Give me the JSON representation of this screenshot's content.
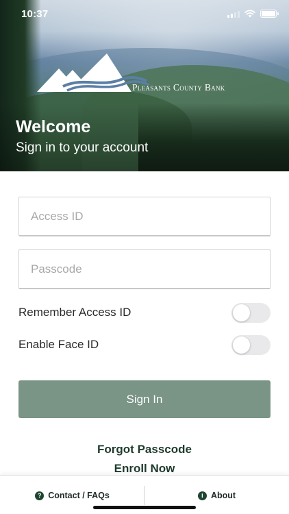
{
  "status_bar": {
    "time": "10:37"
  },
  "brand": {
    "name": "Pleasants County Bank"
  },
  "hero": {
    "title": "Welcome",
    "subtitle": "Sign in to your account"
  },
  "form": {
    "access_id": {
      "placeholder": "Access ID",
      "value": ""
    },
    "passcode": {
      "placeholder": "Passcode",
      "value": ""
    },
    "remember_access_id": {
      "label": "Remember Access ID",
      "on": false
    },
    "enable_face_id": {
      "label": "Enable Face ID",
      "on": false
    },
    "sign_in_label": "Sign In"
  },
  "links": {
    "forgot": "Forgot Passcode",
    "enroll": "Enroll Now"
  },
  "tabbar": {
    "contact": {
      "label": "Contact / FAQs",
      "icon": "question-circle-icon"
    },
    "about": {
      "label": "About",
      "icon": "info-circle-icon"
    }
  },
  "colors": {
    "primary_button": "#7a9486",
    "link_text": "#1d3b2c",
    "tab_icon": "#1f4532"
  }
}
